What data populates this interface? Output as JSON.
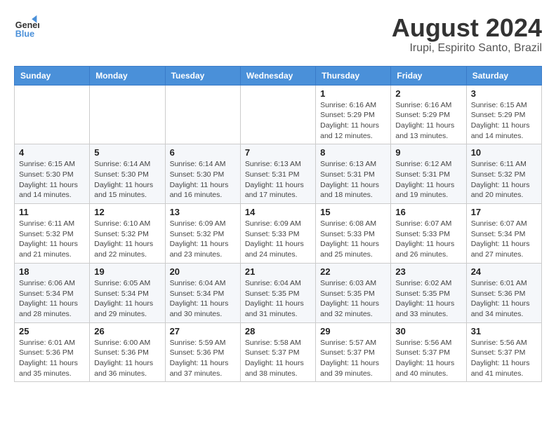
{
  "logo": {
    "line1": "General",
    "line2": "Blue"
  },
  "title": {
    "month_year": "August 2024",
    "location": "Irupi, Espirito Santo, Brazil"
  },
  "weekdays": [
    "Sunday",
    "Monday",
    "Tuesday",
    "Wednesday",
    "Thursday",
    "Friday",
    "Saturday"
  ],
  "weeks": [
    [
      {
        "day": "",
        "info": ""
      },
      {
        "day": "",
        "info": ""
      },
      {
        "day": "",
        "info": ""
      },
      {
        "day": "",
        "info": ""
      },
      {
        "day": "1",
        "info": "Sunrise: 6:16 AM\nSunset: 5:29 PM\nDaylight: 11 hours\nand 12 minutes."
      },
      {
        "day": "2",
        "info": "Sunrise: 6:16 AM\nSunset: 5:29 PM\nDaylight: 11 hours\nand 13 minutes."
      },
      {
        "day": "3",
        "info": "Sunrise: 6:15 AM\nSunset: 5:29 PM\nDaylight: 11 hours\nand 14 minutes."
      }
    ],
    [
      {
        "day": "4",
        "info": "Sunrise: 6:15 AM\nSunset: 5:30 PM\nDaylight: 11 hours\nand 14 minutes."
      },
      {
        "day": "5",
        "info": "Sunrise: 6:14 AM\nSunset: 5:30 PM\nDaylight: 11 hours\nand 15 minutes."
      },
      {
        "day": "6",
        "info": "Sunrise: 6:14 AM\nSunset: 5:30 PM\nDaylight: 11 hours\nand 16 minutes."
      },
      {
        "day": "7",
        "info": "Sunrise: 6:13 AM\nSunset: 5:31 PM\nDaylight: 11 hours\nand 17 minutes."
      },
      {
        "day": "8",
        "info": "Sunrise: 6:13 AM\nSunset: 5:31 PM\nDaylight: 11 hours\nand 18 minutes."
      },
      {
        "day": "9",
        "info": "Sunrise: 6:12 AM\nSunset: 5:31 PM\nDaylight: 11 hours\nand 19 minutes."
      },
      {
        "day": "10",
        "info": "Sunrise: 6:11 AM\nSunset: 5:32 PM\nDaylight: 11 hours\nand 20 minutes."
      }
    ],
    [
      {
        "day": "11",
        "info": "Sunrise: 6:11 AM\nSunset: 5:32 PM\nDaylight: 11 hours\nand 21 minutes."
      },
      {
        "day": "12",
        "info": "Sunrise: 6:10 AM\nSunset: 5:32 PM\nDaylight: 11 hours\nand 22 minutes."
      },
      {
        "day": "13",
        "info": "Sunrise: 6:09 AM\nSunset: 5:32 PM\nDaylight: 11 hours\nand 23 minutes."
      },
      {
        "day": "14",
        "info": "Sunrise: 6:09 AM\nSunset: 5:33 PM\nDaylight: 11 hours\nand 24 minutes."
      },
      {
        "day": "15",
        "info": "Sunrise: 6:08 AM\nSunset: 5:33 PM\nDaylight: 11 hours\nand 25 minutes."
      },
      {
        "day": "16",
        "info": "Sunrise: 6:07 AM\nSunset: 5:33 PM\nDaylight: 11 hours\nand 26 minutes."
      },
      {
        "day": "17",
        "info": "Sunrise: 6:07 AM\nSunset: 5:34 PM\nDaylight: 11 hours\nand 27 minutes."
      }
    ],
    [
      {
        "day": "18",
        "info": "Sunrise: 6:06 AM\nSunset: 5:34 PM\nDaylight: 11 hours\nand 28 minutes."
      },
      {
        "day": "19",
        "info": "Sunrise: 6:05 AM\nSunset: 5:34 PM\nDaylight: 11 hours\nand 29 minutes."
      },
      {
        "day": "20",
        "info": "Sunrise: 6:04 AM\nSunset: 5:34 PM\nDaylight: 11 hours\nand 30 minutes."
      },
      {
        "day": "21",
        "info": "Sunrise: 6:04 AM\nSunset: 5:35 PM\nDaylight: 11 hours\nand 31 minutes."
      },
      {
        "day": "22",
        "info": "Sunrise: 6:03 AM\nSunset: 5:35 PM\nDaylight: 11 hours\nand 32 minutes."
      },
      {
        "day": "23",
        "info": "Sunrise: 6:02 AM\nSunset: 5:35 PM\nDaylight: 11 hours\nand 33 minutes."
      },
      {
        "day": "24",
        "info": "Sunrise: 6:01 AM\nSunset: 5:36 PM\nDaylight: 11 hours\nand 34 minutes."
      }
    ],
    [
      {
        "day": "25",
        "info": "Sunrise: 6:01 AM\nSunset: 5:36 PM\nDaylight: 11 hours\nand 35 minutes."
      },
      {
        "day": "26",
        "info": "Sunrise: 6:00 AM\nSunset: 5:36 PM\nDaylight: 11 hours\nand 36 minutes."
      },
      {
        "day": "27",
        "info": "Sunrise: 5:59 AM\nSunset: 5:36 PM\nDaylight: 11 hours\nand 37 minutes."
      },
      {
        "day": "28",
        "info": "Sunrise: 5:58 AM\nSunset: 5:37 PM\nDaylight: 11 hours\nand 38 minutes."
      },
      {
        "day": "29",
        "info": "Sunrise: 5:57 AM\nSunset: 5:37 PM\nDaylight: 11 hours\nand 39 minutes."
      },
      {
        "day": "30",
        "info": "Sunrise: 5:56 AM\nSunset: 5:37 PM\nDaylight: 11 hours\nand 40 minutes."
      },
      {
        "day": "31",
        "info": "Sunrise: 5:56 AM\nSunset: 5:37 PM\nDaylight: 11 hours\nand 41 minutes."
      }
    ]
  ]
}
